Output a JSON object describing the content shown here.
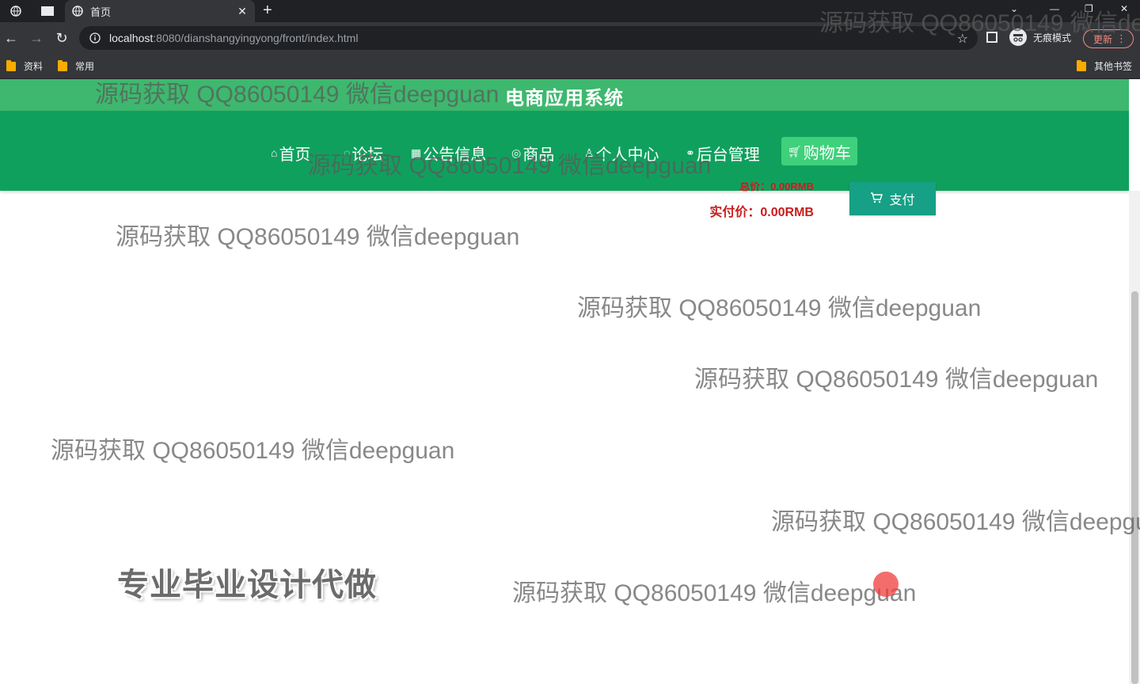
{
  "browser": {
    "tab": {
      "title": "首页"
    },
    "url": {
      "host": "localhost",
      "rest": ":8080/dianshangyingyong/front/index.html"
    },
    "incognito_label": "无痕模式",
    "update_label": "更新",
    "bookmarks": [
      {
        "label": "资料"
      },
      {
        "label": "常用"
      }
    ],
    "other_bookmarks": "其他书签"
  },
  "site": {
    "title": "电商应用系统",
    "nav": [
      {
        "label": "首页",
        "icon": "home-icon"
      },
      {
        "label": "论坛",
        "icon": "forum-icon"
      },
      {
        "label": "公告信息",
        "icon": "notice-icon"
      },
      {
        "label": "商品",
        "icon": "goods-icon"
      },
      {
        "label": "个人中心",
        "icon": "user-icon"
      },
      {
        "label": "后台管理",
        "icon": "link-icon"
      },
      {
        "label": "购物车",
        "icon": "cart-icon",
        "active": true
      }
    ]
  },
  "cart": {
    "total_label": "总价：0.00RMB",
    "actual_label": "实付价：0.00RMB",
    "pay_label": "支付"
  },
  "overlay": {
    "promo": "专业毕业设计代做",
    "watermark": "源码获取 QQ86050149 微信deepguan"
  },
  "colors": {
    "header_green": "#3db86e",
    "nav_green": "#10a05e",
    "active_green": "#3fd07b",
    "price_red": "#c81d1d",
    "pay_teal": "#16a085"
  }
}
